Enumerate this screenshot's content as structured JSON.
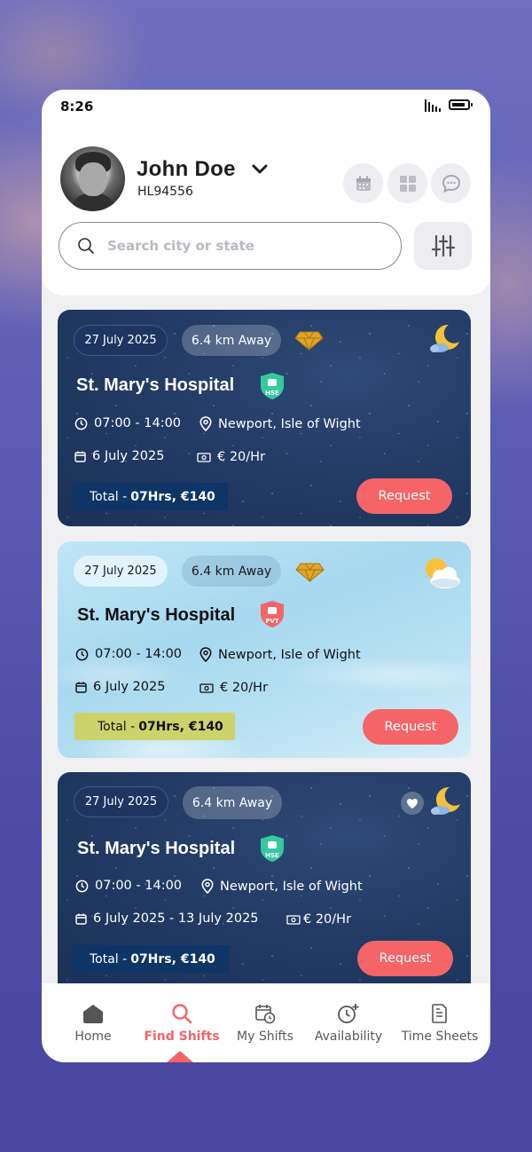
{
  "status": {
    "time": "8:26"
  },
  "profile": {
    "name": "John Doe",
    "id": "HL94556"
  },
  "search": {
    "placeholder": "Search city or state"
  },
  "cards": [
    {
      "theme": "night",
      "date": "27 July  2025",
      "distance": "6.4 km Away",
      "hospital": "St. Mary's Hospital",
      "badge": "HSE",
      "time": "07:00 - 14:00",
      "location": "Newport, Isle of Wight",
      "shift_date": "6 July 2025",
      "rate": "€ 20/Hr",
      "total_prefix": "Total - ",
      "total_value": "07Hrs, €140",
      "request": "Request"
    },
    {
      "theme": "day",
      "date": "27 July  2025",
      "distance": "6.4 km Away",
      "hospital": "St. Mary's Hospital",
      "badge": "PVT",
      "time": "07:00 - 14:00",
      "location": "Newport, Isle of Wight",
      "shift_date": "6 July 2025",
      "rate": "€ 20/Hr",
      "total_prefix": "Total - ",
      "total_value": "07Hrs, €140",
      "request": "Request"
    },
    {
      "theme": "night",
      "date": "27 July  2025",
      "distance": "6.4 km Away",
      "hospital": "St. Mary's Hospital",
      "badge": "HSE",
      "time": "07:00 - 14:00",
      "location": "Newport, Isle of Wight",
      "shift_date": "6 July 2025  - 13 July 2025",
      "rate": "€ 20/Hr",
      "total_prefix": "Total - ",
      "total_value": "07Hrs, €140",
      "request": "Request"
    }
  ],
  "nav": [
    {
      "label": "Home",
      "icon": "home-icon",
      "active": false
    },
    {
      "label": "Find Shifts",
      "icon": "search-icon",
      "active": true
    },
    {
      "label": "My Shifts",
      "icon": "calendar-clock-icon",
      "active": false
    },
    {
      "label": "Availability",
      "icon": "clock-plus-icon",
      "active": false
    },
    {
      "label": "Time Sheets",
      "icon": "document-icon",
      "active": false
    }
  ],
  "colors": {
    "accent": "#f56467",
    "night_card": "#233c66",
    "day_card": "#a7d8ef",
    "hse_badge": "#36c9a0",
    "pvt_badge": "#f56467"
  }
}
